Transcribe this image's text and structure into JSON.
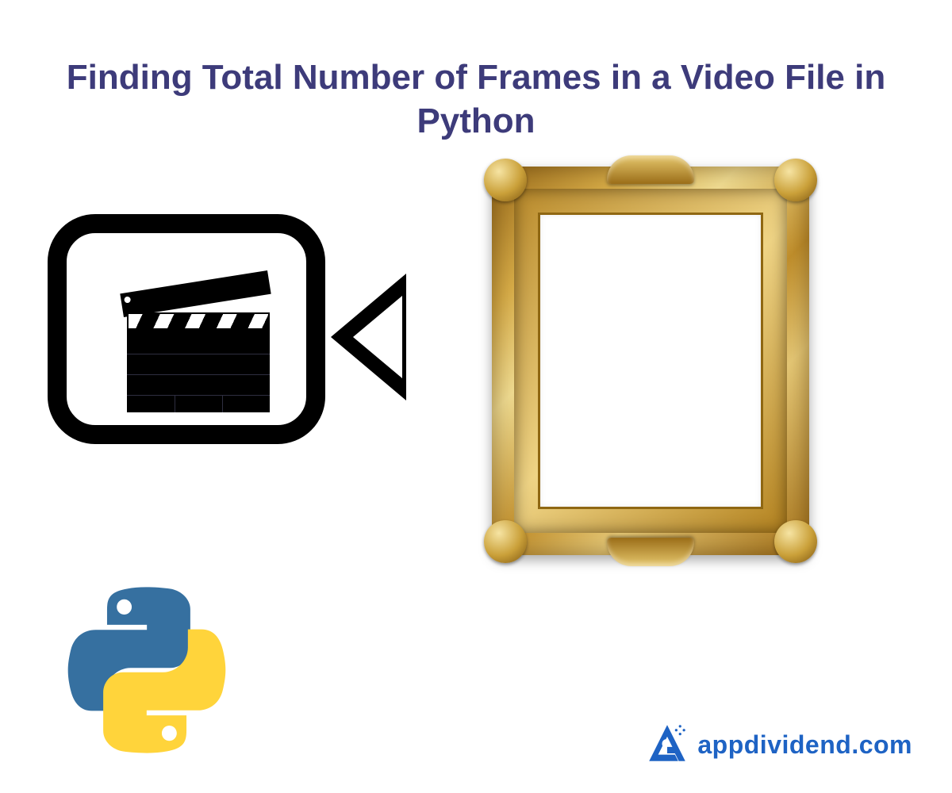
{
  "title": "Finding Total Number of Frames in a Video File in Python",
  "brand": {
    "text": "appdividend.com"
  },
  "icons": {
    "camera": "video-camera-icon",
    "clapper": "clapperboard-icon",
    "frame": "picture-frame-icon",
    "python": "python-logo-icon",
    "brand_logo": "appdividend-logo-icon"
  },
  "colors": {
    "title": "#3d3b7a",
    "brand": "#1e63c4",
    "gold_light": "#e7c86d",
    "gold_dark": "#9a6d18",
    "python_blue": "#3670a0",
    "python_yellow": "#ffd43b"
  }
}
